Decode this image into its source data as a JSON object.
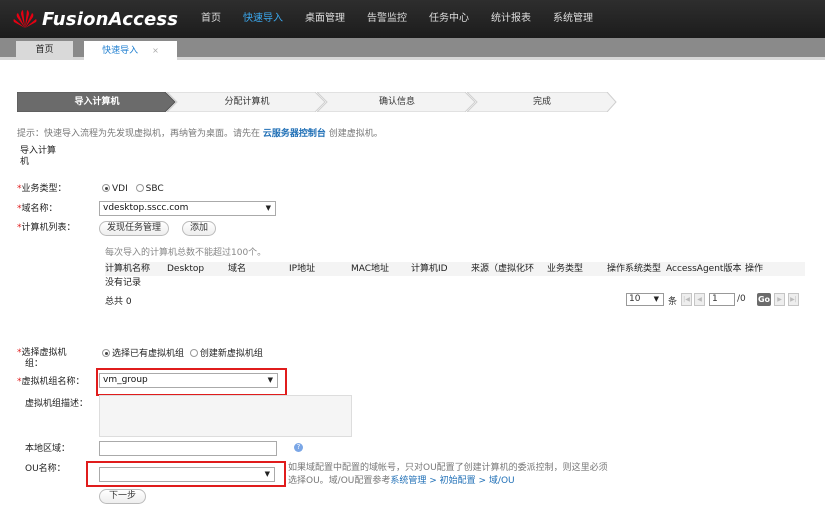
{
  "app": {
    "brand": "FusionAccess"
  },
  "nav": {
    "items": [
      "首页",
      "快速导入",
      "桌面管理",
      "告警监控",
      "任务中心",
      "统计报表",
      "系统管理"
    ],
    "active_index": 1
  },
  "tabs": {
    "home": "首页",
    "quick_import": "快速导入",
    "close_glyph": "×"
  },
  "steps": [
    "导入计算机",
    "分配计算机",
    "确认信息",
    "完成"
  ],
  "hint": {
    "prefix": "提示：快速导入流程为先发现虚拟机，再纳管为桌面。请先在 ",
    "link": "云服务器控制台",
    "suffix": " 创建虚拟机。"
  },
  "section": {
    "title_line1": "导入计算",
    "title_line2": "机"
  },
  "business_type": {
    "label": "业务类型：",
    "options": [
      "VDI",
      "SBC"
    ],
    "selected": "VDI"
  },
  "domain": {
    "label": "域名称：",
    "value": "vdesktop.sscc.com"
  },
  "computer_list": {
    "label": "计算机列表：",
    "discover_button": "发现任务管理",
    "add_button": "添加"
  },
  "grid": {
    "note": "每次导入的计算机总数不能超过100个。",
    "columns": [
      "计算机名称",
      "Desktop",
      "域名",
      "IP地址",
      "MAC地址",
      "计算机ID",
      "来源（虚拟化环",
      "业务类型",
      "操作系统类型",
      "AccessAgent版本",
      "操作"
    ],
    "empty_text": "没有记录",
    "total": "总共 0"
  },
  "pager": {
    "page_size": "10",
    "unit": "条",
    "current_page": "1",
    "total_pages": "/0",
    "go": "Go"
  },
  "vm_group_choice": {
    "label_line1": "选择虚拟机",
    "label_line2": "组：",
    "options": [
      "选择已有虚拟机组",
      "创建新虚拟机组"
    ],
    "selected": "选择已有虚拟机组"
  },
  "vm_group_name": {
    "label": "虚拟机组名称：",
    "value": "vm_group"
  },
  "vm_group_desc": {
    "label": "虚拟机组描述："
  },
  "region": {
    "label": "本地区域：",
    "help": "?"
  },
  "ou": {
    "label": "OU名称：",
    "value": "",
    "note_line1": "如果域配置中配置的域帐号，只对OU配置了创建计算机的委派控制，则这里必须",
    "note_prefix": "选择OU。域/OU配置参考",
    "note_link": "系统管理 > 初始配置 > 域/OU",
    "note_suffix": ""
  },
  "next_button": "下一步",
  "colors": {
    "accent": "#3ba9f0",
    "required": "#e02020",
    "highlight": "#e01c1c",
    "topbar": "#262626"
  }
}
